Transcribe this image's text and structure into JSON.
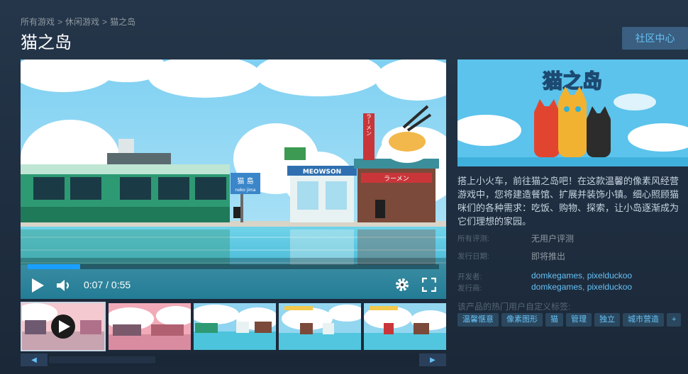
{
  "breadcrumb": [
    "所有游戏",
    "休闲游戏",
    "猫之岛"
  ],
  "breadcrumb_sep": ">",
  "title": "猫之岛",
  "community_button": "社区中心",
  "player": {
    "current_time": "0:07",
    "total_time": "0:55",
    "time_sep": " / ",
    "progress": 0.127,
    "scene_sign_shop": "MEOWSON",
    "scene_sign_station": "猫 島",
    "scene_sign_station_sub": "neko jima",
    "scene_sign_ramen": "ラーメン",
    "scene_sign_ramen_vertical": "ラーメン"
  },
  "capsule": {
    "title": "猫之岛"
  },
  "description": "搭上小火车，前往猫之岛吧！在这款温馨的像素风经营游戏中，您将建造餐馆、扩展并装饰小镇。细心照顾猫咪们的各种需求：吃饭、购物、探索，让小岛逐渐成为它们理想的家园。",
  "reviews": {
    "label": "所有评测:",
    "value": "无用户评测"
  },
  "release": {
    "label": "发行日期:",
    "value": "即将推出"
  },
  "developer": {
    "label": "开发者:",
    "names": [
      "domkegames",
      "pixelduckoo"
    ]
  },
  "publisher": {
    "label": "发行商:",
    "names": [
      "domkegames",
      "pixelduckoo"
    ]
  },
  "tags_title": "该产品的热门用户自定义标签:",
  "tags": [
    "温馨惬意",
    "像素图形",
    "猫",
    "管理",
    "独立",
    "城市营造",
    "+"
  ],
  "colors": {
    "accent": "#66c0f4",
    "background": "#1b2838",
    "tag_bg": "#2a475e",
    "progress": "#1a9fff"
  },
  "icons": {
    "play": "play-icon",
    "volume": "volume-icon",
    "settings": "gear-icon",
    "fullscreen": "fullscreen-icon",
    "scroll_left": "chevron-left-icon",
    "scroll_right": "chevron-right-icon"
  }
}
